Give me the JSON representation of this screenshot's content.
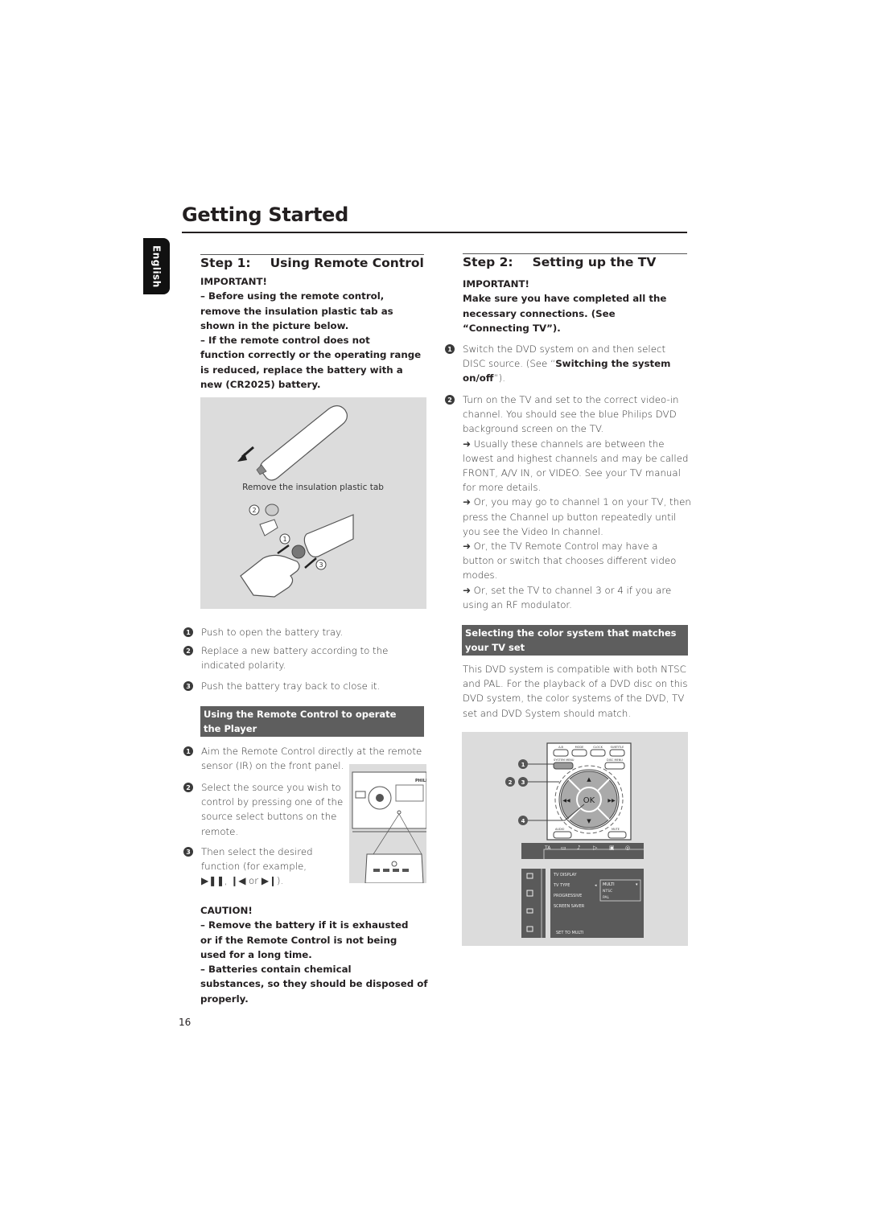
{
  "page": {
    "title": "Getting Started",
    "language_tab": "English",
    "page_number": "16"
  },
  "step1": {
    "title_step": "Step 1:",
    "title_text": "Using Remote Control",
    "important_label": "IMPORTANT!",
    "important_lines": [
      "–  Before using the remote control,",
      "remove the insulation plastic tab as",
      "shown in the picture below.",
      "–  If the remote control does not",
      "function correctly or the operating range",
      "is reduced, replace the battery with a",
      "new (CR2025) battery."
    ],
    "figure_caption": "Remove the insulation plastic tab",
    "figure_callouts": [
      "1",
      "2",
      "3"
    ],
    "steps": [
      {
        "num": "1",
        "lines": [
          "Push to open the battery tray."
        ]
      },
      {
        "num": "2",
        "lines": [
          "Replace a new battery according to the",
          "indicated polarity."
        ]
      },
      {
        "num": "3",
        "lines": [
          "Push the battery tray back to close it."
        ]
      }
    ],
    "section_heading_lines": [
      "Using the Remote Control to operate",
      "the Player"
    ],
    "operate_steps": [
      {
        "num": "1",
        "lines": [
          "Aim the Remote Control directly at the remote",
          "sensor (IR) on the front panel."
        ]
      },
      {
        "num": "2",
        "lines": [
          "Select the source you wish to",
          "control by pressing one of the",
          "source select buttons on the",
          "remote."
        ]
      },
      {
        "num": "3",
        "lines": [
          "Then select the desired",
          "function (for example,",
          " ▶❚❚, ❙◀ or ▶❙)."
        ]
      }
    ],
    "device_brand": "PHILIPS",
    "caution_label": "CAUTION!",
    "caution_lines": [
      "–  Remove the battery if it is exhausted",
      "or if the Remote Control is not being",
      "used for a long time.",
      "–  Batteries contain chemical",
      "substances, so they should be disposed of",
      "properly."
    ]
  },
  "step2": {
    "title_step": "Step 2:",
    "title_text": "Setting up the TV",
    "important_label": "IMPORTANT!",
    "important_lines": [
      "Make sure you have completed all the",
      "necessary connections. (See",
      "“Connecting TV”)."
    ],
    "item1": {
      "num": "1",
      "line1": "Switch the DVD system on and then select",
      "line2_pre": "DISC source. (See “",
      "line2_bold": "Switching the system",
      "line3_bold": "on/off",
      "line3_post": "”)."
    },
    "item2": {
      "num": "2",
      "lines": [
        "Turn on the TV and set to the correct video-in",
        "channel. You should see the blue Philips DVD",
        "background screen on the TV.",
        "➜ Usually these channels are between the",
        "lowest and highest channels and may be called",
        "FRONT, A/V IN, or VIDEO. See your TV manual",
        "for more details.",
        "➜ Or, you may go to channel 1 on your TV, then",
        "press the Channel up button repeatedly until",
        "you see the Video In channel.",
        "➜ Or, the TV Remote Control may have a",
        "button or switch that chooses different video",
        "modes.",
        "➜ Or, set the TV to channel 3 or 4 if you are",
        "using an RF modulator."
      ]
    },
    "section_heading_lines": [
      "Selecting the color system that matches",
      "your TV set"
    ],
    "color_paragraph": [
      "This DVD system is compatible with both NTSC",
      "and PAL. For the playback of a DVD disc on this",
      "DVD system, the color systems of the DVD, TV",
      "set and DVD System should match."
    ],
    "remote_figure": {
      "top_buttons": [
        "A-B",
        "MODE",
        "CLOCK",
        "SUBTITLE"
      ],
      "system_menu": "SYSTEM MENU",
      "disc_menu": "DISC MENU",
      "ok": "OK",
      "audio": "AUDIO",
      "mute": "MUTE",
      "callouts": [
        "1",
        "2",
        "3",
        "4"
      ]
    },
    "osd": {
      "top_icons": [
        "TA",
        "▭",
        "♪",
        "▷",
        "▣",
        "◎"
      ],
      "left_icons": [
        "picture-icon",
        "speaker-icon",
        "subtitle-icon",
        "tv-icon"
      ],
      "menu_items": [
        "TV DISPLAY",
        "TV TYPE",
        "PROGRESSIVE",
        "SCREEN SAVER"
      ],
      "options": [
        "MULTI",
        "NTSC",
        "PAL"
      ],
      "selected_option": "MULTI",
      "footer": "SET TO MULTI"
    }
  }
}
